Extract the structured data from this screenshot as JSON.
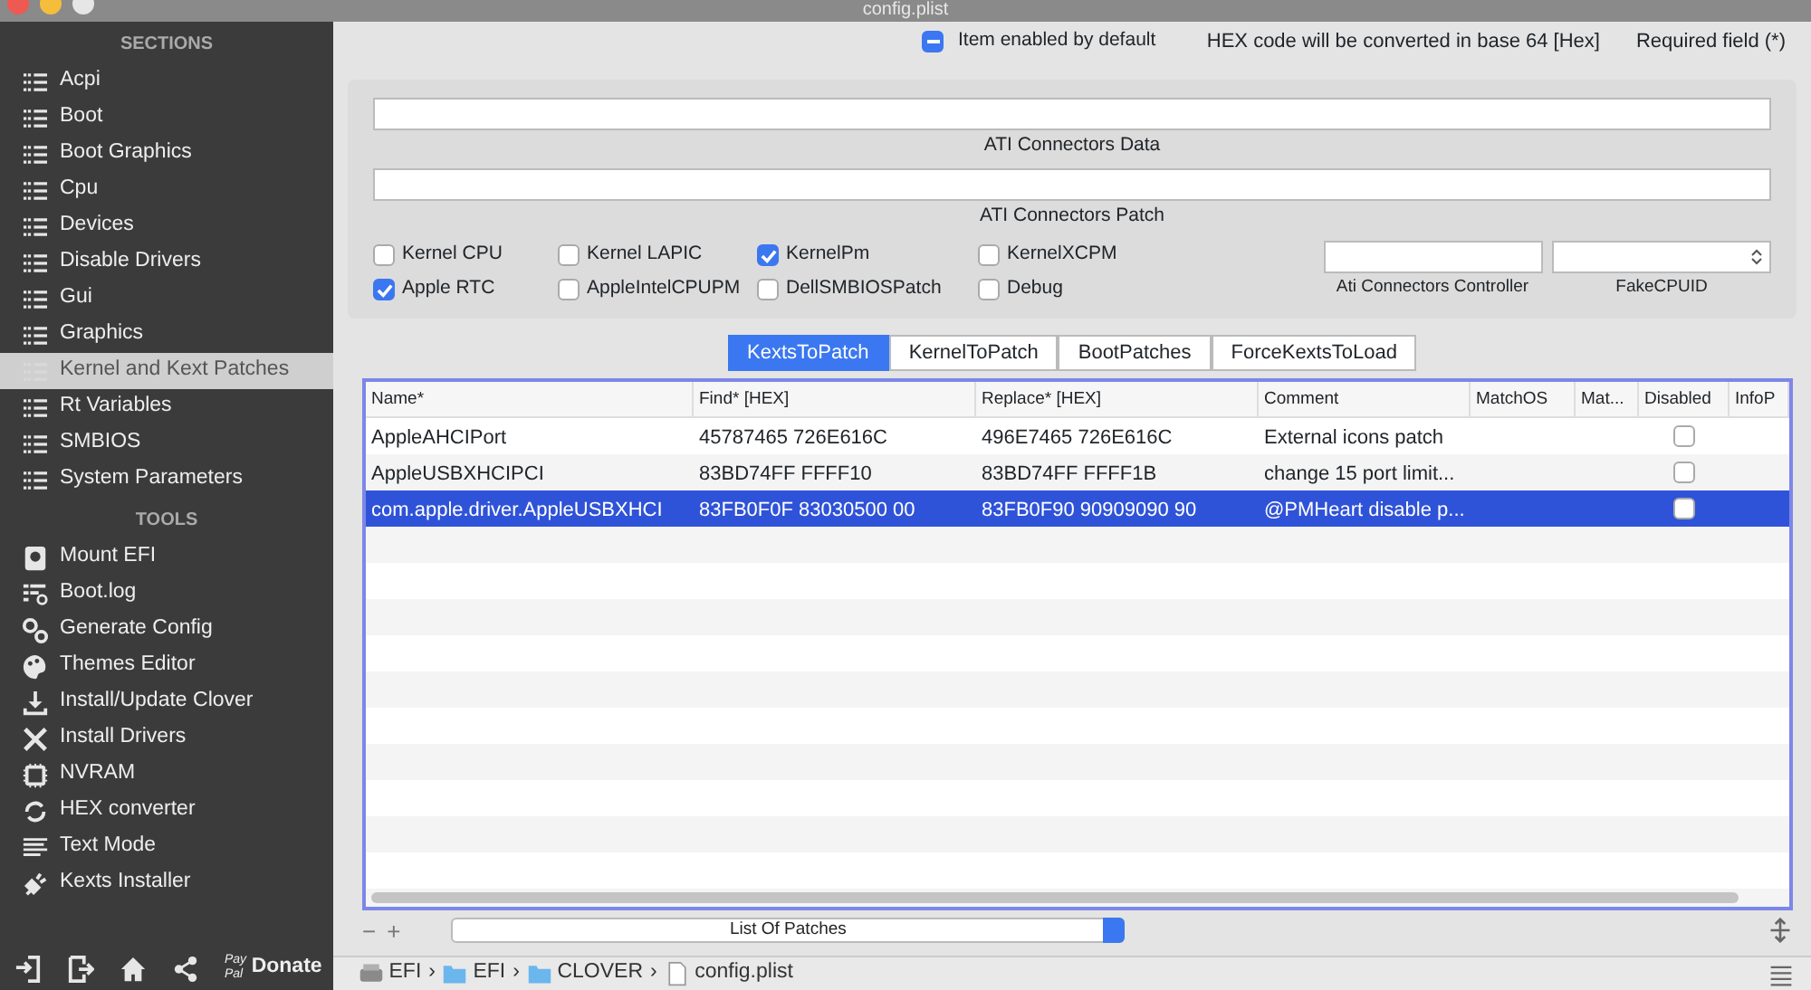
{
  "window": {
    "title": "config.plist"
  },
  "sidebar": {
    "sections_header": "SECTIONS",
    "sections": [
      {
        "label": "Acpi",
        "selected": false
      },
      {
        "label": "Boot",
        "selected": false
      },
      {
        "label": "Boot Graphics",
        "selected": false
      },
      {
        "label": "Cpu",
        "selected": false
      },
      {
        "label": "Devices",
        "selected": false
      },
      {
        "label": "Disable Drivers",
        "selected": false
      },
      {
        "label": "Gui",
        "selected": false
      },
      {
        "label": "Graphics",
        "selected": false
      },
      {
        "label": "Kernel and Kext Patches",
        "selected": true
      },
      {
        "label": "Rt Variables",
        "selected": false
      },
      {
        "label": "SMBIOS",
        "selected": false
      },
      {
        "label": "System Parameters",
        "selected": false
      }
    ],
    "tools_header": "TOOLS",
    "tools": [
      {
        "label": "Mount EFI",
        "kind": "disk"
      },
      {
        "label": "Boot.log",
        "kind": "log"
      },
      {
        "label": "Generate Config",
        "kind": "gears"
      },
      {
        "label": "Themes Editor",
        "kind": "palette"
      },
      {
        "label": "Install/Update Clover",
        "kind": "download"
      },
      {
        "label": "Install Drivers",
        "kind": "tools"
      },
      {
        "label": "NVRAM",
        "kind": "chip"
      },
      {
        "label": "HEX converter",
        "kind": "refresh"
      },
      {
        "label": "Text Mode",
        "kind": "lines"
      },
      {
        "label": "Kexts Installer",
        "kind": "plug"
      }
    ],
    "footer": {
      "buttons": [
        {
          "kind": "import"
        },
        {
          "kind": "export"
        },
        {
          "kind": "home"
        },
        {
          "kind": "share"
        }
      ],
      "paypal_top": "Pay",
      "paypal_bottom": "Pal",
      "donate": "Donate"
    }
  },
  "header": {
    "legend": {
      "label": "Item enabled by default",
      "indeterminate": true
    },
    "hex_note": "HEX code will be converted in base 64 [Hex]",
    "required_note": "Required field (*)"
  },
  "panel": {
    "fields": [
      {
        "label": "ATI Connectors Data"
      },
      {
        "label": "ATI Connectors Patch"
      }
    ],
    "checkbox_rows": [
      [
        {
          "label": "Kernel CPU",
          "checked": false
        },
        {
          "label": "Kernel LAPIC",
          "checked": false
        },
        {
          "label": "KernelPm",
          "checked": true
        },
        {
          "label": "KernelXCPM",
          "checked": false
        }
      ],
      [
        {
          "label": "Apple RTC",
          "checked": true
        },
        {
          "label": "AppleIntelCPUPM",
          "checked": false
        },
        {
          "label": "DellSMBIOSPatch",
          "checked": false
        },
        {
          "label": "Debug",
          "checked": false
        }
      ]
    ],
    "controller_label": "Ati Connectors Controller",
    "cpuid_label": "FakeCPUID"
  },
  "tabs": [
    {
      "label": "KextsToPatch",
      "selected": true
    },
    {
      "label": "KernelToPatch",
      "selected": false
    },
    {
      "label": "BootPatches",
      "selected": false
    },
    {
      "label": "ForceKextsToLoad",
      "selected": false
    }
  ],
  "table": {
    "columns": [
      "Name*",
      "Find* [HEX]",
      "Replace* [HEX]",
      "Comment",
      "MatchOS",
      "Mat...",
      "Disabled",
      "InfoP"
    ],
    "rows": [
      {
        "cells": [
          "AppleAHCIPort",
          "45787465 726E616C",
          "496E7465 726E616C",
          "External icons patch"
        ],
        "disabled": false,
        "selected": false
      },
      {
        "cells": [
          "AppleUSBXHCIPCI",
          "83BD74FF FFFF10",
          "83BD74FF FFFF1B",
          "change 15 port limit..."
        ],
        "disabled": false,
        "selected": false
      },
      {
        "cells": [
          "com.apple.driver.AppleUSBXHCI",
          "83FB0F0F 83030500 00",
          "83FB0F90 90909090 90",
          "@PMHeart disable p..."
        ],
        "disabled": false,
        "selected": true
      }
    ]
  },
  "list_controls": {
    "minus": "−",
    "plus": "+",
    "popup": "List Of Patches"
  },
  "path_bar": [
    {
      "label": "EFI",
      "kind": "drive"
    },
    {
      "separator": "›",
      "label": "EFI",
      "kind": "folder"
    },
    {
      "separator": "›",
      "label": "CLOVER",
      "kind": "folder"
    },
    {
      "separator": "›",
      "label": "config.plist",
      "kind": "file"
    }
  ]
}
